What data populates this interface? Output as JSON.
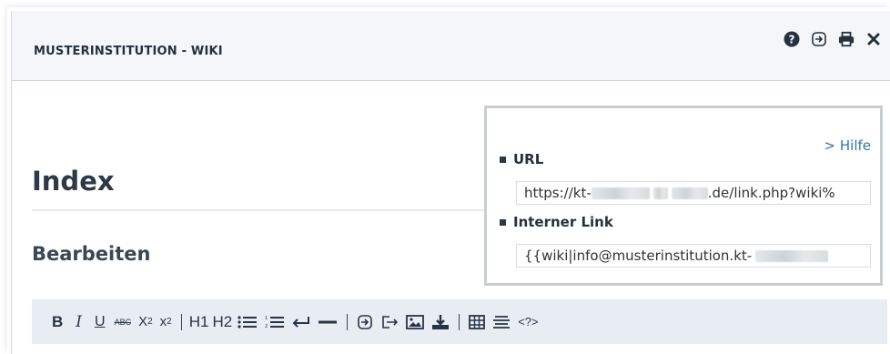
{
  "window": {
    "title": "MUSTERINSTITUTION - WIKI",
    "icons": [
      "help-icon",
      "export-icon",
      "print-icon",
      "close-icon"
    ]
  },
  "page": {
    "heading": "Index",
    "subheading": "Bearbeiten"
  },
  "popup": {
    "help_link": "> Hilfe",
    "url_label": "URL",
    "url_value_start": "https://kt-",
    "url_value_end": ".de/link.php?wiki%",
    "internal_label": "Interner Link",
    "internal_value_start": "{{wiki|info@musterinstitution.kt-"
  },
  "toolbar": {
    "bold": "B",
    "italic": "I",
    "underline": "U",
    "strike": "ABC",
    "subscript": "X",
    "subscript_sub": "2",
    "superscript": "x",
    "superscript_sup": "2",
    "h1": "H1",
    "h2": "H2",
    "code": "<?>"
  },
  "colors": {
    "titlebar_bg": "#f4f6f9",
    "toolbar_bg": "#e8ecf3",
    "link": "#3572b0",
    "heading": "#2d3945"
  }
}
